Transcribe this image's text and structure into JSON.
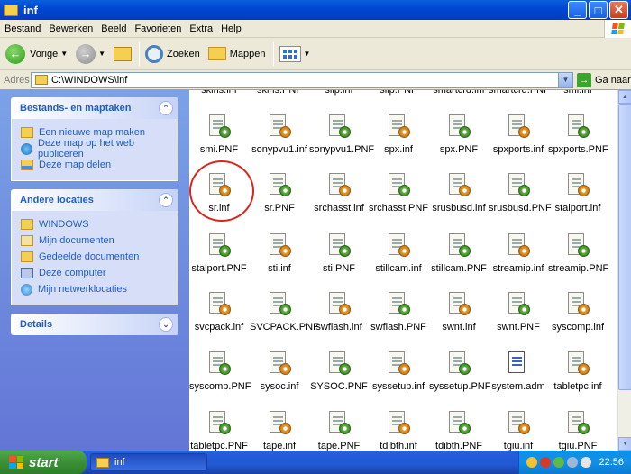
{
  "window": {
    "title": "inf"
  },
  "menu": [
    "Bestand",
    "Bewerken",
    "Beeld",
    "Favorieten",
    "Extra",
    "Help"
  ],
  "toolbar": {
    "back": "Vorige",
    "search": "Zoeken",
    "folders": "Mappen"
  },
  "address": {
    "label": "Adres",
    "value": "C:\\WINDOWS\\inf",
    "go": "Ga naar"
  },
  "tasks": {
    "title": "Bestands- en maptaken",
    "items": [
      "Een nieuwe map maken",
      "Deze map op het web publiceren",
      "Deze map delen"
    ]
  },
  "places": {
    "title": "Andere locaties",
    "items": [
      "WINDOWS",
      "Mijn documenten",
      "Gedeelde documenten",
      "Deze computer",
      "Mijn netwerklocaties"
    ]
  },
  "details": {
    "title": "Details"
  },
  "partial_top": [
    "skins.inf",
    "skins.PNF",
    "slip.inf",
    "slip.PNF",
    "smartcrd.inf",
    "smartcrd.PNF",
    "smi.inf"
  ],
  "files": [
    [
      "smi.PNF",
      "sonypvu1.inf",
      "sonypvu1.PNF",
      "spx.inf",
      "spx.PNF",
      "spxports.inf",
      "spxports.PNF"
    ],
    [
      "sr.inf",
      "sr.PNF",
      "srchasst.inf",
      "srchasst.PNF",
      "srusbusd.inf",
      "srusbusd.PNF",
      "stalport.inf"
    ],
    [
      "stalport.PNF",
      "sti.inf",
      "sti.PNF",
      "stillcam.inf",
      "stillcam.PNF",
      "streamip.inf",
      "streamip.PNF"
    ],
    [
      "svcpack.inf",
      "SVCPACK.PNF",
      "swflash.inf",
      "swflash.PNF",
      "swnt.inf",
      "swnt.PNF",
      "syscomp.inf"
    ],
    [
      "syscomp.PNF",
      "sysoc.inf",
      "SYSOC.PNF",
      "syssetup.inf",
      "syssetup.PNF",
      "system.adm",
      "tabletpc.inf"
    ],
    [
      "tabletpc.PNF",
      "tape.inf",
      "tape.PNF",
      "tdibth.inf",
      "tdibth.PNF",
      "tgiu.inf",
      "tgiu.PNF"
    ]
  ],
  "taskbar": {
    "start": "start",
    "task": "inf",
    "clock": "22:56"
  }
}
